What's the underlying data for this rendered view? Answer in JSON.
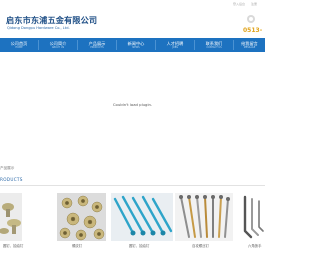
{
  "topbar": {
    "login_label": "登入后台",
    "register_label": "注册"
  },
  "header": {
    "company_name_cn": "启东市东浦五金有限公司",
    "company_name_en": "Qidong Dongpu Hardware Co., Ltd.",
    "phone_partial": "0513-"
  },
  "nav": {
    "items": [
      {
        "cn": "公司首页",
        "en": "HOME"
      },
      {
        "cn": "公司简介",
        "en": "ABOUT US"
      },
      {
        "cn": "产品展示",
        "en": "PRODUCTS"
      },
      {
        "cn": "新闻中心",
        "en": "NEWS"
      },
      {
        "cn": "人才招聘",
        "en": "JOBS"
      },
      {
        "cn": "联系我们",
        "en": "CONTACT US"
      },
      {
        "cn": "给我留言",
        "en": "MESSAGE"
      }
    ]
  },
  "plugin": {
    "message": "Couldn't load plugin."
  },
  "breadcrumb": "产品展示",
  "section": {
    "title": "RODUCTS"
  },
  "products": {
    "captions": [
      "圆钉、抽油钉",
      "螺纹钉",
      "圆钉、抽油钉",
      "自攻螺丝钉",
      "六角扳手"
    ]
  },
  "colors": {
    "nav_bg": "#1d72c0",
    "logo_text": "#1f4f86",
    "phone_accent": "#e0a31a"
  }
}
